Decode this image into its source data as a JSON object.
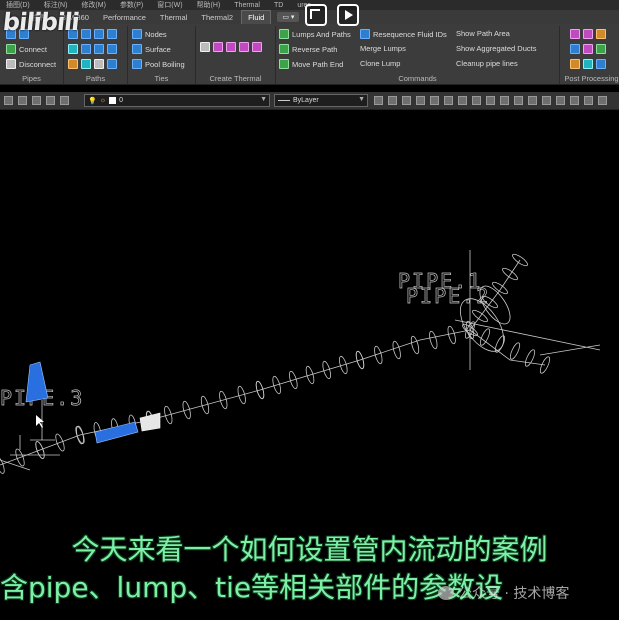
{
  "menu": [
    "插图(D)",
    "标注(N)",
    "修改(M)",
    "参数(P)",
    "窗口(W)",
    "帮助(H)",
    "Thermal",
    "TD",
    "ures"
  ],
  "tabs": [
    {
      "label": "插件"
    },
    {
      "label": "BIM 360"
    },
    {
      "label": "Performance"
    },
    {
      "label": "Thermal"
    },
    {
      "label": "Thermal2"
    },
    {
      "label": "Fluid",
      "active": true
    }
  ],
  "tab_control": "▭ ▾",
  "ribbon": {
    "pipes": {
      "title": "Pipes",
      "connect": "Connect",
      "disconnect": "Disconnect"
    },
    "paths": {
      "title": "Paths"
    },
    "ties": {
      "title": "Ties",
      "nodes": "Nodes",
      "surface": "Surface",
      "pool_boiling": "Pool Boiling"
    },
    "create_thermal": {
      "title": "Create Thermal"
    },
    "commands": {
      "title": "Commands",
      "lumps_and_paths": "Lumps And Paths",
      "reverse_path": "Reverse Path",
      "move_path_end": "Move Path End",
      "resequence": "Resequence Fluid IDs",
      "merge_lumps": "Merge Lumps",
      "clone_lump": "Clone Lump",
      "show_path_area": "Show Path Area",
      "show_aggregated_ducts": "Show Aggregated Ducts",
      "cleanup_pipe_lines": "Cleanup pipe lines"
    },
    "post_processing": {
      "title": "Post Processing"
    }
  },
  "toolbar": {
    "layer_value": "0",
    "linetype_value": "ByLayer"
  },
  "drawing": {
    "label1": "PIPE.1",
    "label2": "PIPE.2",
    "label3": "PIPE.3"
  },
  "overlay": {
    "logo": "bilibili",
    "subtitle1": "今天来看一个如何设置管内流动的案例",
    "subtitle2": "含pipe、lump、tie等相关部件的参数设",
    "watermark": "公众号 · 技术博客"
  },
  "colors": {
    "subtitle": "#7df0a6",
    "cone_highlight": "#2a6fe0",
    "wireframe": "#c8c8c8"
  }
}
